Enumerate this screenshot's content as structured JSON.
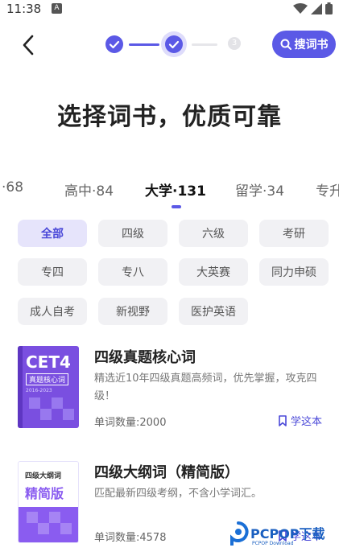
{
  "status_bar": {
    "time": "11:38",
    "notif_icon": "A"
  },
  "header": {
    "step3_label": "3",
    "search_label": "搜词书",
    "page_title": "选择词书，优质可靠"
  },
  "tabs": [
    {
      "label": "·68",
      "active": false
    },
    {
      "label": "高中·84",
      "active": false
    },
    {
      "label": "大学·131",
      "active": true
    },
    {
      "label": "留学·34",
      "active": false
    },
    {
      "label": "专升",
      "active": false
    }
  ],
  "chips": [
    "全部",
    "四级",
    "六级",
    "考研",
    "专四",
    "专八",
    "大英赛",
    "同力申硕",
    "成人自考",
    "新视野",
    "医护英语"
  ],
  "selected_chip": "全部",
  "books": [
    {
      "title": "四级真题核心词",
      "desc": "精选近10年四级真题高频词，优先掌握，攻克四级！",
      "count": "单词数量:2000",
      "action": "学这本",
      "cover_main": "CET4",
      "cover_sub": "真题核心词",
      "cover_year": "2016-2023",
      "cover_color": "#7a4fe0"
    },
    {
      "title": "四级大纲词（精简版）",
      "desc": "匹配最新四级考纲，不含小学词汇。",
      "count": "单词数量:4578",
      "action": "学这本",
      "cover_top": "四级大纲词",
      "cover_main": "精简版",
      "cover_color": "#8a5cf0"
    }
  ],
  "watermark": {
    "main": "PCPOP下载",
    "sub": "PCPOP Download"
  },
  "colors": {
    "accent": "#5b59e6",
    "chip_bg": "#f1f1f4",
    "chip_sel_bg": "#e6e4fb"
  }
}
